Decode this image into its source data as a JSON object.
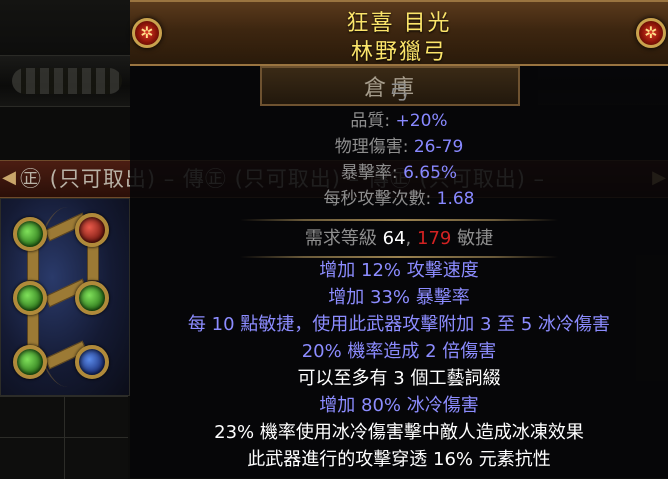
{
  "header": {
    "item_name": "狂喜 目光",
    "item_base": "林野獵弓",
    "emblem_glyph": "✲"
  },
  "stash_label": "倉庫",
  "item_type": "弓",
  "properties": [
    {
      "label": "品質: ",
      "value": "+20%"
    },
    {
      "label": "物理傷害: ",
      "value": "26-79"
    },
    {
      "label": "暴擊率: ",
      "value": "6.65%"
    },
    {
      "label": "每秒攻擊次數: ",
      "value": "1.68"
    }
  ],
  "requirements": {
    "prefix": "需求等級 ",
    "level": "64",
    "sep": ", ",
    "dex": "179",
    "suffix": " 敏捷"
  },
  "mods": [
    "增加 12% 攻擊速度",
    "增加 33% 暴擊率",
    "每 10 點敏捷，使用此武器攻擊附加 3 至 5 冰冷傷害",
    "20% 機率造成 2 倍傷害",
    "可以至多有 3 個工藝詞綴",
    "增加 80% 冰冷傷害",
    "23% 機率使用冰冷傷害擊中敵人造成冰凍效果",
    "此武器進行的攻擊穿透 16% 元素抗性"
  ],
  "mod_colors": [
    "mod",
    "mod",
    "mod",
    "mod",
    "white",
    "mod",
    "white",
    "white"
  ],
  "tab_strip": {
    "text": "㊣ (只可取出) – 傳㊣ (只可取出) – 傳㊣ (只可取出) –",
    "left_arrow": "◀",
    "right_arrow": "▶"
  },
  "sockets": [
    "green",
    "red",
    "green",
    "green",
    "green",
    "blue"
  ],
  "colors": {
    "unique_name": "#fbe46a",
    "property_label": "#8e8e8e",
    "magic_value": "#8888ff",
    "requirement_unmet": "#d22222"
  }
}
